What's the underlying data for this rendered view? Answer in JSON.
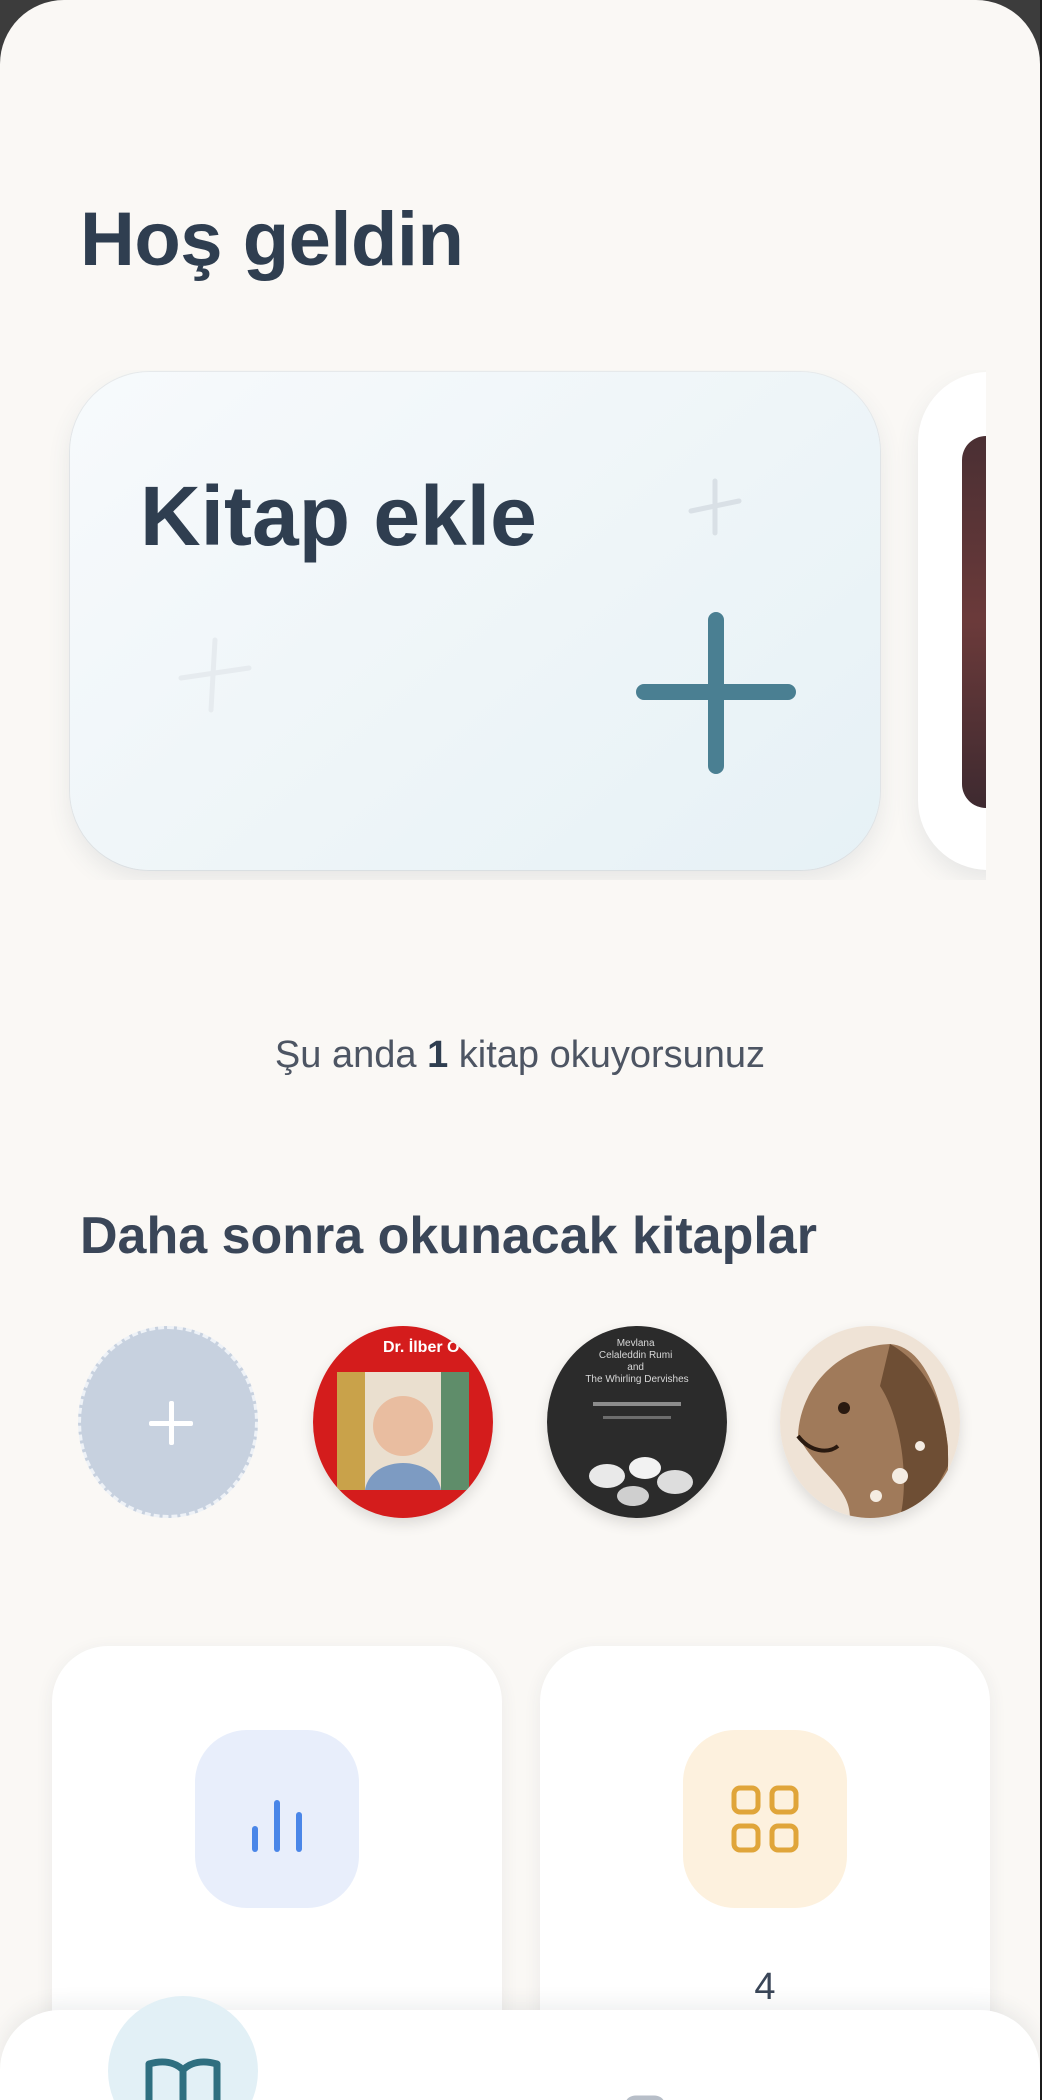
{
  "header": {
    "greeting": "Hoş geldin"
  },
  "carousel": {
    "add_card_title": "Kitap ekle",
    "add_icon": "plus-icon"
  },
  "reading_status": {
    "prefix": "Şu anda",
    "count": "1",
    "suffix": "kitap okuyorsunuz"
  },
  "later_reads": {
    "title": "Daha sonra okunacak kitaplar",
    "add_icon": "plus-icon",
    "books": [
      {
        "cover_text": "Dr. İlber O",
        "icon": "book-cover-portrait"
      },
      {
        "cover_text": "Mevlana Celaleddin Rumi and The Whirling Dervishes",
        "icon": "book-cover-dervishes"
      },
      {
        "cover_text": "",
        "icon": "book-cover-horse"
      }
    ]
  },
  "stats": {
    "left": {
      "icon": "bar-chart-icon",
      "value": ""
    },
    "right": {
      "icon": "grid-icon",
      "value": "4"
    }
  },
  "bottom_nav": {
    "items": [
      {
        "icon": "book-open-icon",
        "active": true
      },
      {
        "icon": "nav-icon-2",
        "active": false
      },
      {
        "icon": "nav-icon-3",
        "active": false
      }
    ]
  },
  "colors": {
    "background": "#faf8f5",
    "title": "#2f3e50",
    "accent_teal": "#4a7f92",
    "stat_blue": "#4a86e8",
    "stat_amber": "#e0a53a"
  }
}
